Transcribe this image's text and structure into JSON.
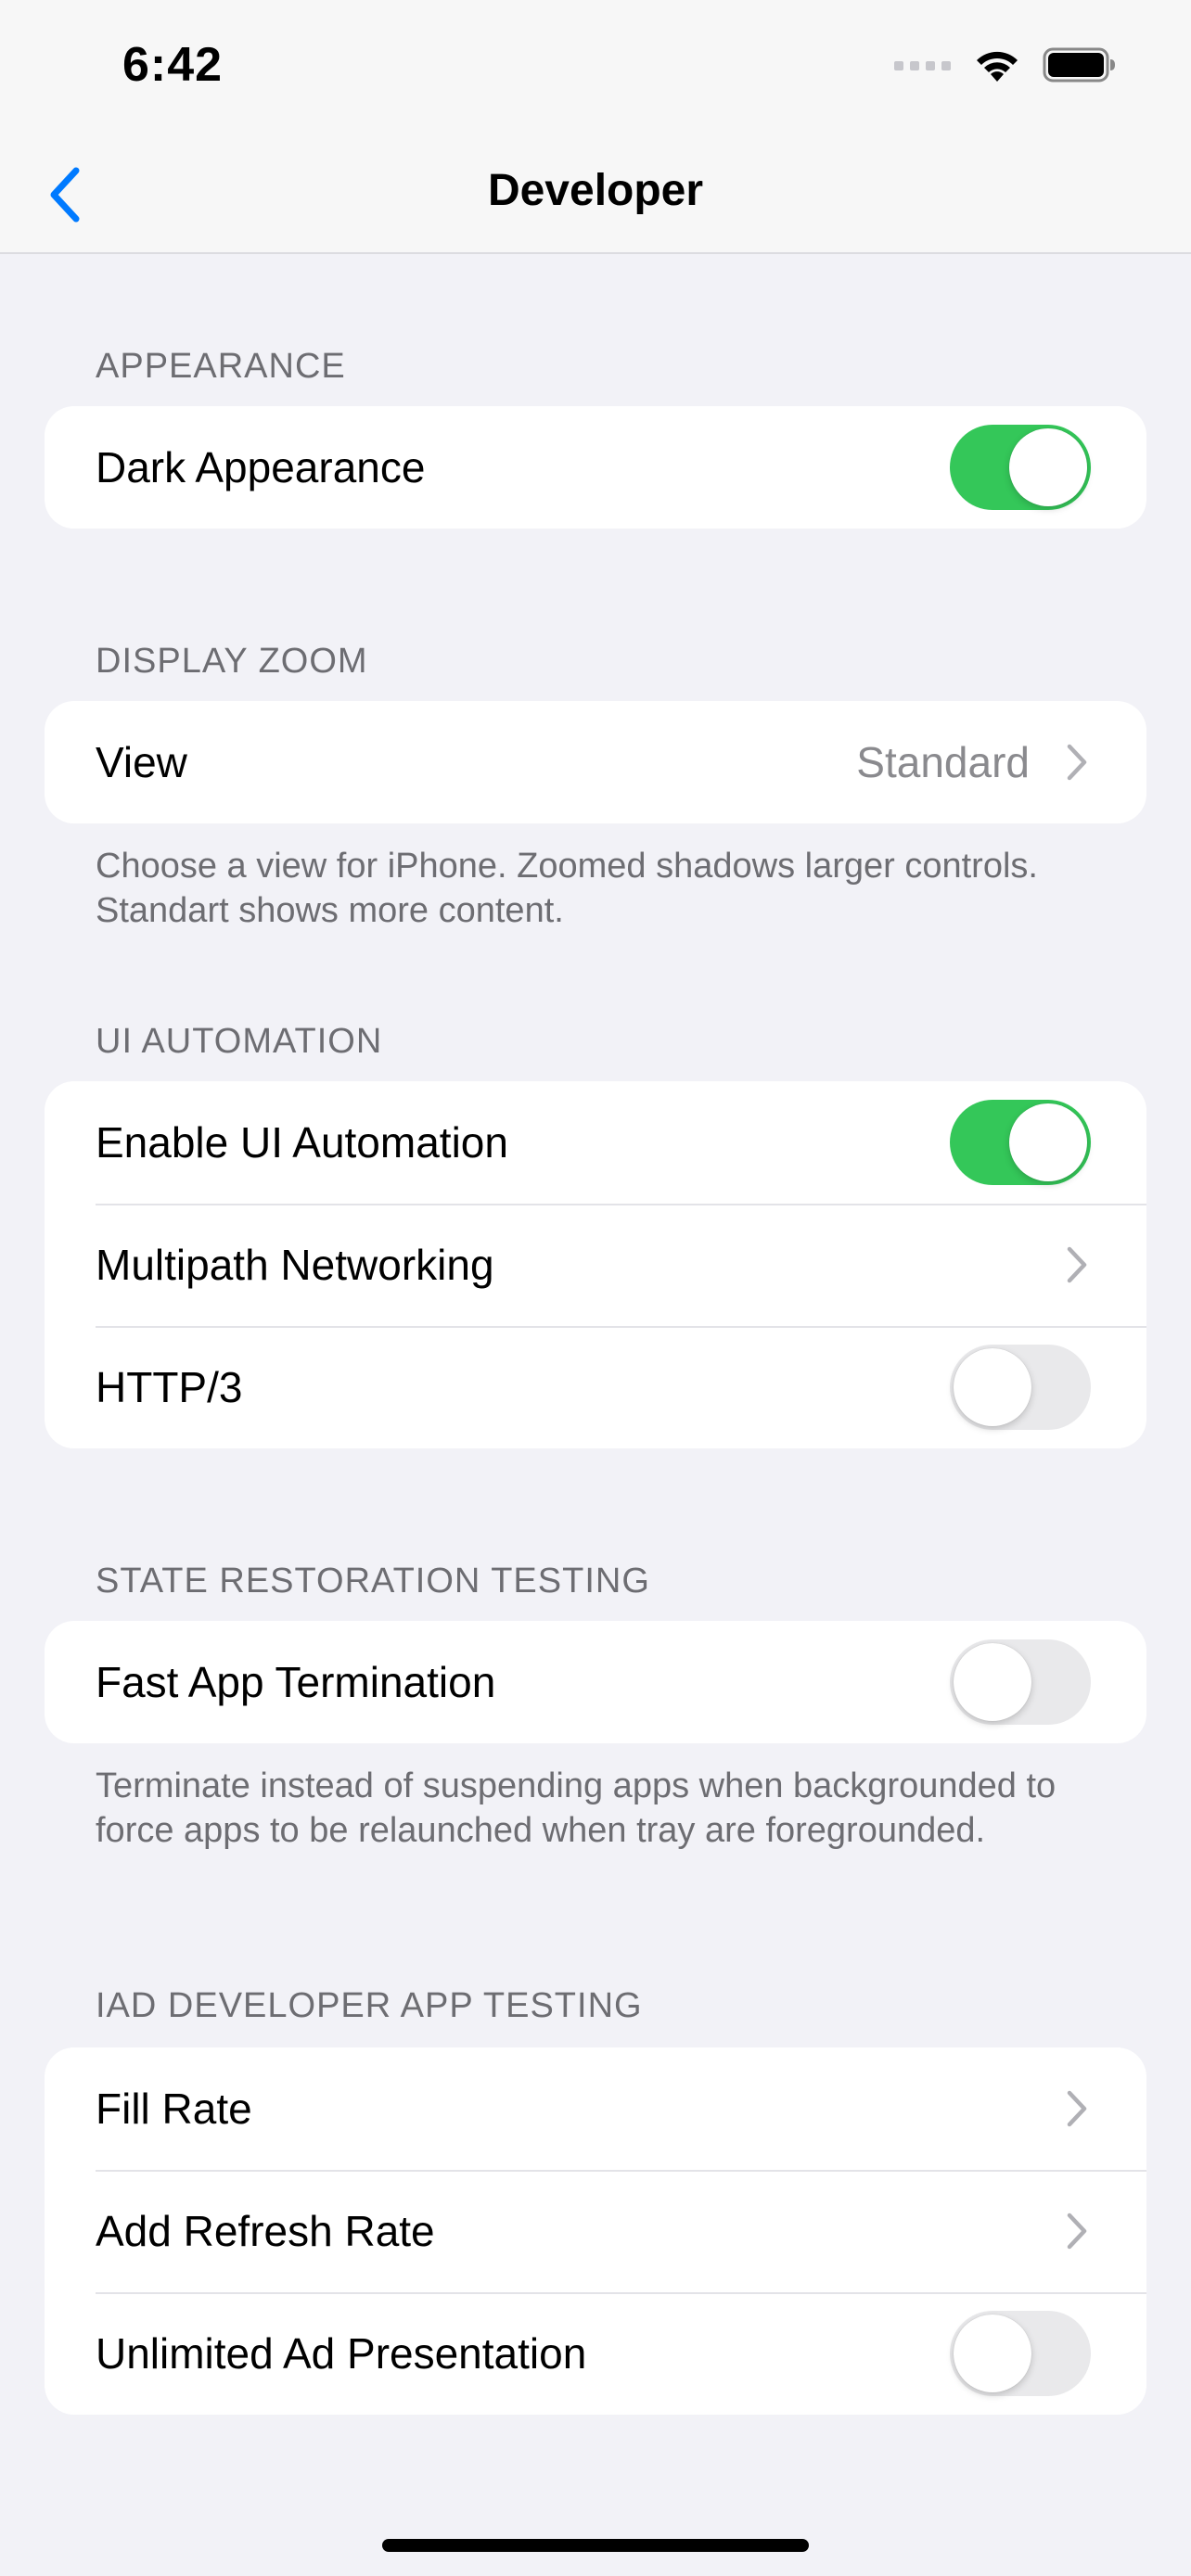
{
  "status_bar": {
    "time": "6:42",
    "icons": [
      "signal-icon",
      "wifi-icon",
      "battery-icon"
    ]
  },
  "nav": {
    "title": "Developer",
    "back_icon": "chevron-left-icon",
    "accent": "#007aff"
  },
  "colors": {
    "toggle_on": "#34c759",
    "toggle_off": "#e9e9eb",
    "background": "#f2f2f7"
  },
  "sections": {
    "appearance": {
      "header": "APPEARANCE",
      "rows": [
        {
          "label": "Dark Appearance",
          "control": "toggle",
          "on": true
        }
      ]
    },
    "display_zoom": {
      "header": "DISPLAY ZOOM",
      "rows": [
        {
          "label": "View",
          "value": "Standard",
          "control": "chevron"
        }
      ],
      "footer": "Choose a view for iPhone. Zoomed shadows larger controls. Standart shows more content."
    },
    "ui_automation": {
      "header": "UI AUTOMATION",
      "rows": [
        {
          "label": "Enable UI Automation",
          "control": "toggle",
          "on": true
        },
        {
          "label": "Multipath Networking",
          "control": "chevron"
        },
        {
          "label": "HTTP/3",
          "control": "toggle",
          "on": false
        }
      ]
    },
    "state_restoration": {
      "header": "STATE RESTORATION TESTING",
      "rows": [
        {
          "label": "Fast App Termination",
          "control": "toggle",
          "on": false
        }
      ],
      "footer": "Terminate instead of suspending apps when backgrounded to force apps to be relaunched when tray are foregrounded."
    },
    "iad_testing": {
      "header": "IAD DEVELOPER APP TESTING",
      "rows": [
        {
          "label": "Fill Rate",
          "control": "chevron"
        },
        {
          "label": "Add Refresh Rate",
          "control": "chevron"
        },
        {
          "label": "Unlimited Ad Presentation",
          "control": "toggle",
          "on": false
        }
      ]
    }
  }
}
